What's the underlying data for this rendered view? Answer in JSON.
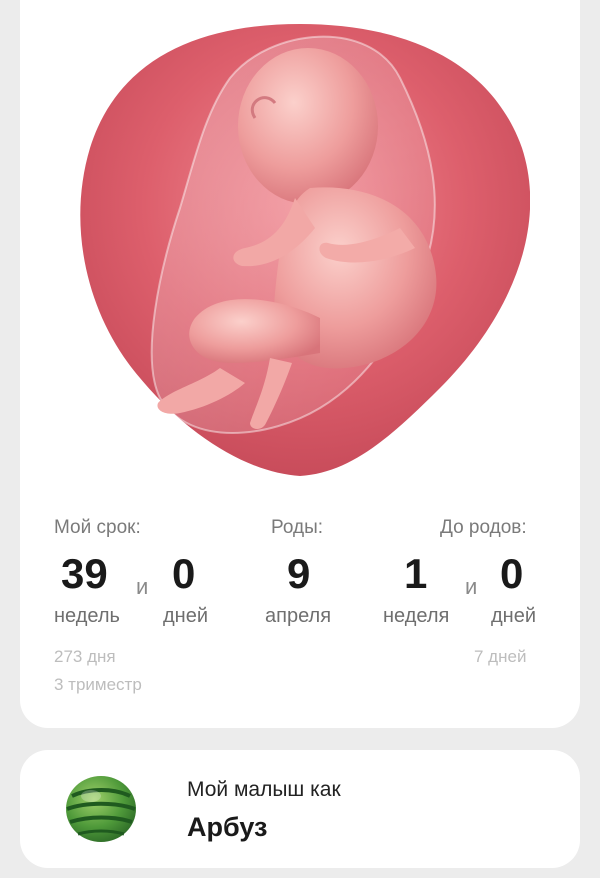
{
  "illustration": {
    "icon": "fetus-illustration"
  },
  "pregnancy_term": {
    "label": "Мой срок:",
    "weeks": "39",
    "weeks_unit": "недель",
    "connector": "и",
    "days": "0",
    "days_unit": "дней",
    "total_days": "273 дня",
    "trimester": "3 триместр"
  },
  "due_date": {
    "label": "Роды:",
    "day": "9",
    "month": "апреля"
  },
  "countdown": {
    "label": "До родов:",
    "weeks": "1",
    "weeks_unit": "неделя",
    "connector": "и",
    "days": "0",
    "days_unit": "дней",
    "total_days": "7 дней"
  },
  "baby_size": {
    "caption": "Мой малыш как",
    "fruit": "Арбуз",
    "icon": "watermelon-icon"
  }
}
